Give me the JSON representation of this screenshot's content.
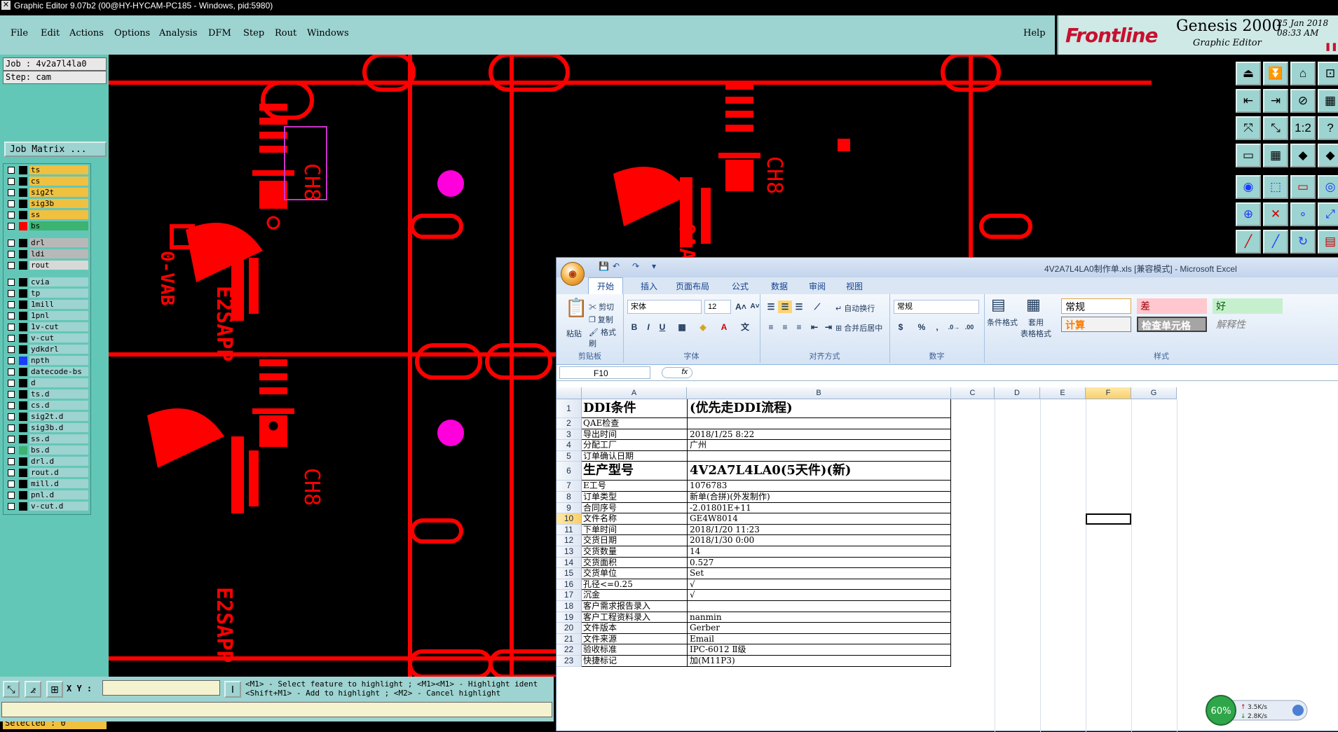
{
  "titlebar": {
    "text": "Graphic Editor 9.07b2 (00@HY-HYCAM-PC185 - Windows, pid:5980)"
  },
  "menu": [
    "File",
    "Edit",
    "Actions",
    "Options",
    "Analysis",
    "DFM",
    "Step",
    "Rout",
    "Windows"
  ],
  "help": "Help",
  "brand": {
    "logo": "Frontline",
    "product": "Genesis 2000",
    "subtitle": "Graphic Editor",
    "date": "25 Jan 2018",
    "time": "08:33 AM",
    "accent": "#c8102e"
  },
  "job": {
    "job_label": "Job : 4v2a7l4la0",
    "step_label": "Step: cam",
    "matrix_button": "Job Matrix ..."
  },
  "layers": [
    {
      "name": "ts",
      "color": "#f0c040",
      "swatch": "#000000"
    },
    {
      "name": "cs",
      "color": "#f0c040",
      "swatch": "#000000"
    },
    {
      "name": "sig2t",
      "color": "#f0c040",
      "swatch": "#000000"
    },
    {
      "name": "sig3b",
      "color": "#f0c040",
      "swatch": "#000000"
    },
    {
      "name": "ss",
      "color": "#f0c040",
      "swatch": "#000000"
    },
    {
      "name": "bs",
      "color": "#3cb371",
      "swatch": "#ff0000"
    },
    {
      "name": "drl",
      "color": "#b8b8b8",
      "swatch": "#000000"
    },
    {
      "name": "ldi",
      "color": "#b8b8b8",
      "swatch": "#000000"
    },
    {
      "name": "rout",
      "color": "#d8d8d8",
      "swatch": "#000000"
    },
    {
      "name": "cvia",
      "color": "#9dd3d0",
      "swatch": "#000000"
    },
    {
      "name": "tp",
      "color": "#9dd3d0",
      "swatch": "#000000"
    },
    {
      "name": "1mill",
      "color": "#9dd3d0",
      "swatch": "#000000"
    },
    {
      "name": "1pnl",
      "color": "#9dd3d0",
      "swatch": "#000000"
    },
    {
      "name": "1v-cut",
      "color": "#9dd3d0",
      "swatch": "#000000"
    },
    {
      "name": "v-cut",
      "color": "#9dd3d0",
      "swatch": "#000000"
    },
    {
      "name": "ydkdrl",
      "color": "#9dd3d0",
      "swatch": "#000000"
    },
    {
      "name": "npth",
      "color": "#9dd3d0",
      "swatch": "#1a3cff"
    },
    {
      "name": "datecode-bs",
      "color": "#9dd3d0",
      "swatch": "#000000"
    },
    {
      "name": "d",
      "color": "#9dd3d0",
      "swatch": "#000000"
    },
    {
      "name": "ts.d",
      "color": "#9dd3d0",
      "swatch": "#000000"
    },
    {
      "name": "cs.d",
      "color": "#9dd3d0",
      "swatch": "#000000"
    },
    {
      "name": "sig2t.d",
      "color": "#9dd3d0",
      "swatch": "#000000"
    },
    {
      "name": "sig3b.d",
      "color": "#9dd3d0",
      "swatch": "#000000"
    },
    {
      "name": "ss.d",
      "color": "#9dd3d0",
      "swatch": "#000000"
    },
    {
      "name": "bs.d",
      "color": "#9dd3d0",
      "swatch": "#3cb371"
    },
    {
      "name": "drl.d",
      "color": "#9dd3d0",
      "swatch": "#000000"
    },
    {
      "name": "rout.d",
      "color": "#9dd3d0",
      "swatch": "#000000"
    },
    {
      "name": "mill.d",
      "color": "#9dd3d0",
      "swatch": "#000000"
    },
    {
      "name": "pnl.d",
      "color": "#9dd3d0",
      "swatch": "#000000"
    },
    {
      "name": "v-cut.d",
      "color": "#9dd3d0",
      "swatch": "#000000"
    }
  ],
  "selected": "Selected : 0",
  "xy_label": "X Y :",
  "hint": "<M1> - Select feature to highlight ; <M1><M1> - Highlight ident\n<Shift+M1> - Add to highlight ; <M2> - Cancel highlight",
  "canvas": {
    "text_8": "8",
    "text_a": "CH8",
    "silk_color": "#ff0000",
    "npth_color": "#ff00dc",
    "select_color": "#cc33cc"
  },
  "toolbox_icons": [
    "push-icon",
    "push-down-icon",
    "home-icon",
    "zoom-icon",
    "left-icon",
    "right-icon",
    "ratio-icon",
    "grid-icon",
    "fit-icon",
    "fit-small-icon",
    "scale-icon",
    "help-icon",
    "measure-icon",
    "grid2-icon",
    "pad-icon",
    "pad2-icon",
    "feature-icon",
    "flip-icon",
    "ruler-icon",
    "circle-icon",
    "net-icon",
    "cross-icon",
    "dot-icon",
    "link-icon",
    "line-icon",
    "slash-icon",
    "arc-icon",
    "fr-icon"
  ],
  "excel": {
    "title": "4V2A7L4LA0制作单.xls  [兼容模式]  -  Microsoft Excel",
    "tabs": [
      "开始",
      "插入",
      "页面布局",
      "公式",
      "数据",
      "审阅",
      "视图"
    ],
    "clipboard": {
      "paste": "粘贴",
      "cut": "剪切",
      "copy": "复制",
      "format_painter": "格式刷",
      "group": "剪贴板"
    },
    "font": {
      "name": "宋体",
      "size": "12",
      "group": "字体"
    },
    "align": {
      "wrap": "自动换行",
      "merge": "合并后居中",
      "group": "对齐方式"
    },
    "number": {
      "format": "常规",
      "group": "数字"
    },
    "styles": {
      "cond": "条件格式",
      "table": "套用\n表格格式",
      "normal": "常规",
      "bad": "差",
      "good": "好",
      "calc": "计算",
      "check": "检查单元格",
      "explain": "解释性",
      "group": "样式"
    },
    "namebox": "F10",
    "fx": "fx",
    "col_headers": [
      "A",
      "B",
      "C",
      "D",
      "E",
      "F",
      "G"
    ],
    "rows": [
      {
        "n": "1",
        "a": "DDI条件",
        "b": "(优先走DDI流程)",
        "big": true
      },
      {
        "n": "2",
        "a": "QAE检查",
        "b": ""
      },
      {
        "n": "3",
        "a": "导出时间",
        "b": "2018/1/25 8:22"
      },
      {
        "n": "4",
        "a": "分配工厂",
        "b": "广州"
      },
      {
        "n": "5",
        "a": "订单确认日期",
        "b": ""
      },
      {
        "n": "6",
        "a": "生产型号",
        "b": "4V2A7L4LA0(5天件)(新)",
        "big": true
      },
      {
        "n": "7",
        "a": "E工号",
        "b": "1076783"
      },
      {
        "n": "8",
        "a": "订单类型",
        "b": "新单(合拼)(外发制作)"
      },
      {
        "n": "9",
        "a": "合同序号",
        "b": "-2.01801E+11"
      },
      {
        "n": "10",
        "a": "文件名称",
        "b": "GE4W8014"
      },
      {
        "n": "11",
        "a": "下单时间",
        "b": "2018/1/20 11:23"
      },
      {
        "n": "12",
        "a": "交货日期",
        "b": "2018/1/30 0:00"
      },
      {
        "n": "13",
        "a": "交货数量",
        "b": "14"
      },
      {
        "n": "14",
        "a": "交货面积",
        "b": "0.527"
      },
      {
        "n": "15",
        "a": "交货单位",
        "b": "Set"
      },
      {
        "n": "16",
        "a": "孔径<=0.25",
        "b": "√"
      },
      {
        "n": "17",
        "a": "沉金",
        "b": "√"
      },
      {
        "n": "18",
        "a": "客户需求报告录入",
        "b": ""
      },
      {
        "n": "19",
        "a": "客户工程资料录入",
        "b": "nanmin"
      },
      {
        "n": "20",
        "a": "文件版本",
        "b": "Gerber"
      },
      {
        "n": "21",
        "a": "文件来源",
        "b": "Email"
      },
      {
        "n": "22",
        "a": "验收标准",
        "b": "IPC-6012 Ⅱ级"
      },
      {
        "n": "23",
        "a": "快捷标记",
        "b": "加(M11P3)"
      }
    ]
  },
  "net": {
    "percent": "60%",
    "up": "3.5K/s",
    "down": "2.8K/s"
  }
}
